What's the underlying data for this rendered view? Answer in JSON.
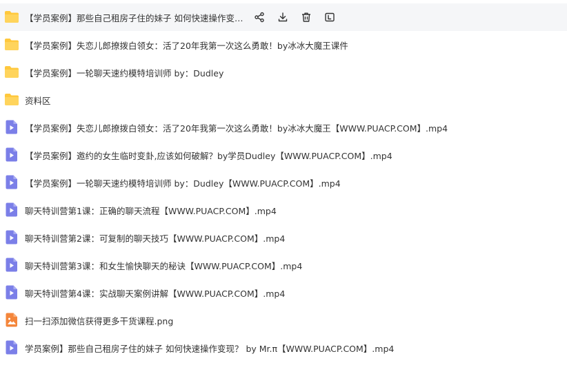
{
  "files": [
    {
      "type": "folder",
      "name": "【学员案例】那些自己租房子住的妹子 如何快速操作变现？ by Mr.π"
    },
    {
      "type": "folder",
      "name": "【学员案例】失恋儿郎撩拨白领女：活了20年我第一次这么勇敢！by冰冰大魔王课件"
    },
    {
      "type": "folder",
      "name": "【学员案例】一轮聊天速约模特培训师 by：Dudley"
    },
    {
      "type": "folder",
      "name": "资料区"
    },
    {
      "type": "video",
      "name": "【学员案例】失恋儿郎撩拨白领女：活了20年我第一次这么勇敢！by冰冰大魔王【WWW.PUACP.COM】.mp4"
    },
    {
      "type": "video",
      "name": "【学员案例】邀约的女生临时变卦,应该如何破解？by学员Dudley【WWW.PUACP.COM】.mp4"
    },
    {
      "type": "video",
      "name": "【学员案例】一轮聊天速约模特培训师 by：Dudley【WWW.PUACP.COM】.mp4"
    },
    {
      "type": "video",
      "name": "聊天特训营第1课：正确的聊天流程【WWW.PUACP.COM】.mp4"
    },
    {
      "type": "video",
      "name": "聊天特训营第2课：可复制的聊天技巧【WWW.PUACP.COM】.mp4"
    },
    {
      "type": "video",
      "name": "聊天特训营第3课：和女生愉快聊天的秘诀【WWW.PUACP.COM】.mp4"
    },
    {
      "type": "video",
      "name": "聊天特训营第4课：实战聊天案例讲解【WWW.PUACP.COM】.mp4"
    },
    {
      "type": "image",
      "name": "扫一扫添加微信获得更多干货课程.png"
    },
    {
      "type": "video",
      "name": "学员案例】那些自己租房子住的妹子 如何快速操作变现？ by Mr.π【WWW.PUACP.COM】.mp4"
    }
  ],
  "hover_actions": [
    "share-icon",
    "download-icon",
    "delete-icon",
    "rename-icon"
  ],
  "colors": {
    "folder": "#FFC83D",
    "video": "#7B7FE8",
    "image": "#F4863B",
    "text": "#333333",
    "hover_background": "#F5F6F8"
  }
}
